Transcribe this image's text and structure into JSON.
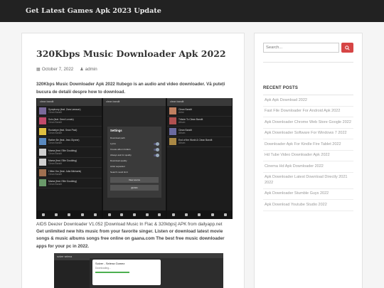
{
  "site": {
    "title": "Get Latest Games Apk 2023 Update"
  },
  "post": {
    "title": "320Kbps Music Downloader Apk 2022",
    "date": "October 7, 2022",
    "author": "admin",
    "intro": "320Kbps Music Downloader Apk 2022  Itubego is an audio and video downloader. Vă puteți bucura de detalii despre how to download.",
    "image_caption_line": "AIDS Deezer Downloader V1.052 [Download Music In Flac & 320kbps] APK from dailyapp.net",
    "body_text": "Get unlimited new hits music from your favorite singer. Listen or download latest movie songs & music albums songs free online on gaana.com The best free music downloader apps for your pc in 2022."
  },
  "screenshot": {
    "left_search": "clean bandit",
    "right_search": "clean bandit",
    "settings_title": "Settings",
    "settings_rows": [
      "Download path",
      "Lyrics",
      "Create album folders",
      "Always ask for quality",
      "Download quality",
      "Artist separator",
      "Search result limit"
    ],
    "settings_button_1": "View source",
    "settings_button_2": "@2021",
    "left_rows": [
      {
        "title": "Symphony (feat. Zara Larsson)",
        "sub": "Clean Bandit",
        "thumb": "#7a6a9a"
      },
      {
        "title": "Solo (feat. Demi Lovato)",
        "sub": "Clean Bandit",
        "thumb": "#c24a6a"
      },
      {
        "title": "Rockabye (feat. Sean Paul)",
        "sub": "Clean Bandit",
        "thumb": "#e0c040"
      },
      {
        "title": "Rather Be (feat. Jess Glynne)",
        "sub": "Clean Bandit",
        "thumb": "#5a8ac0"
      },
      {
        "title": "Mama (feat. Ellie Goulding)",
        "sub": "Clean Bandit",
        "thumb": "#d0d0d0"
      },
      {
        "title": "Mama (feat. Ellie Goulding)",
        "sub": "Clean Bandit",
        "thumb": "#d0d0d0"
      },
      {
        "title": "I Miss You (feat. Julia Michaels)",
        "sub": "Clean Bandit",
        "thumb": "#a07050"
      },
      {
        "title": "Mama (feat. Ellie Goulding)",
        "sub": "Clean Bandit",
        "thumb": "#6a9a6a"
      }
    ],
    "right_rows": [
      {
        "title": "Clean Bandit",
        "sub": "Artist",
        "thumb": "#c08060"
      },
      {
        "title": "Tribute To Clean Bandit",
        "sub": "Album",
        "thumb": "#b05050"
      },
      {
        "title": "Clean Bandit",
        "sub": "Album",
        "thumb": "#6a6aa0"
      },
      {
        "title": "End of the World & Clean Bandit",
        "sub": "Album",
        "thumb": "#aa8844"
      }
    ],
    "second_search": "solver selena",
    "second_card_title": "Solver - Selena Gomez",
    "second_card_sub": "Downloading..."
  },
  "sidebar": {
    "search_placeholder": "Search...",
    "recent_heading": "RECENT POSTS",
    "recent_posts": [
      "Apk Apk Download 2022",
      "Fast File Downloader For Android Apk 2022",
      "Apk Downloader Chrome Web Store Google 2022",
      "Apk Downloader Software For Windows 7 2022",
      "Downloader Apk For Kindle Fire Tablet 2022",
      "Hd Tube Video Downloader Apk 2022",
      "Cinema Hd Apk Downloader 2022",
      "Apk Downloader Latest Download Directly 2021 2022",
      "Apk Downloader Stumble Guys 2022",
      "Apk Download Youtube Studio 2022"
    ]
  },
  "colors": {
    "topbar": "#222222",
    "accent": "#d64545",
    "link": "#999999"
  }
}
